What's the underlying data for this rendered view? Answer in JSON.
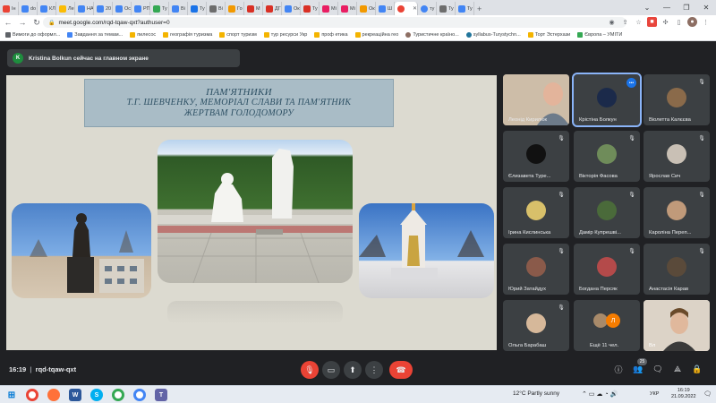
{
  "browser": {
    "tabs": [
      {
        "label": "Ін",
        "color": "#ea4335"
      },
      {
        "label": "do",
        "color": "#4285f4"
      },
      {
        "label": "КЛ",
        "color": "#4285f4"
      },
      {
        "label": "Ле",
        "color": "#fbbc04"
      },
      {
        "label": "НА",
        "color": "#4285f4"
      },
      {
        "label": "20",
        "color": "#4285f4"
      },
      {
        "label": "Ос",
        "color": "#4285f4"
      },
      {
        "label": "РП",
        "color": "#4285f4"
      },
      {
        "label": "Ту",
        "color": "#34a853"
      },
      {
        "label": "Ві",
        "color": "#4285f4"
      },
      {
        "label": "Ту",
        "color": "#1a73e8"
      },
      {
        "label": "Ві",
        "color": "#6d6d6d"
      },
      {
        "label": "Го",
        "color": "#f29900"
      },
      {
        "label": "М",
        "color": "#d93025"
      },
      {
        "label": "ДГ",
        "color": "#d93025"
      },
      {
        "label": "Ок",
        "color": "#4285f4"
      },
      {
        "label": "Ту",
        "color": "#d93025"
      },
      {
        "label": "Мі",
        "color": "#e91e63"
      },
      {
        "label": "Мі",
        "color": "#e91e63"
      },
      {
        "label": "Ок",
        "color": "#f29900"
      },
      {
        "label": "Ш",
        "color": "#4285f4"
      },
      {
        "label": "",
        "color": "#ea4335"
      },
      {
        "label": "ту",
        "color": "#4285f4"
      },
      {
        "label": "Ту",
        "color": "#6d6d6d"
      },
      {
        "label": "Ту",
        "color": "#4285f4"
      }
    ],
    "url": "meet.google.com/rqd-tqaw-qxt?authuser=0",
    "bookmarks": [
      "Вимоги до оформл...",
      "Завдання за темам...",
      "пилесос",
      "географія туризма",
      "спорт туризм",
      "тур ресурси Укр",
      "проф етика",
      "рекреаційна гео",
      "Туристичне країно...",
      "syllabus-Turystychn...",
      "Торт Эстерхази",
      "Європа – УМІТИ"
    ]
  },
  "meet": {
    "presenter_initial": "K",
    "presenter_banner": "Kristina Bolkun сейчас на главном экране",
    "slide": {
      "title": "ПАМ'ЯТНИКИ",
      "subtitle_line1": "Т.Г. ШЕВЧЕНКУ, МЕМОРІАЛ СЛАВИ ТА ПАМ'ЯТНИК",
      "subtitle_line2": "ЖЕРТВАМ ГОЛОДОМОРУ"
    },
    "participants": [
      "Леонід Кирилюк",
      "Крістіна Болкун",
      "Віолетта Калєєва",
      "Єлизавета Туре...",
      "Вікторія Фасова",
      "Ярослав Сич",
      "Ірина Кислинська",
      "Дамір Купрешві...",
      "Кароліна Переп...",
      "Юрий Затайдух",
      "Богдана Персяк",
      "Анастасія Карав",
      "Ольга Барабаш",
      "Ещё 11 чел.",
      "Вл"
    ],
    "more_avatar_initial": "Л",
    "meeting_time": "16:19",
    "meeting_code": "rqd-tqaw-qxt",
    "people_count": "25"
  },
  "taskbar": {
    "weather": "12°C  Partly sunny",
    "language": "УКР",
    "time": "16:19",
    "date": "21.09.2022"
  },
  "colors": {
    "meet_bg": "#202124",
    "tile_bg": "#3c4043",
    "end_call": "#ea4335",
    "speaking_outline": "#8ab4f8"
  }
}
